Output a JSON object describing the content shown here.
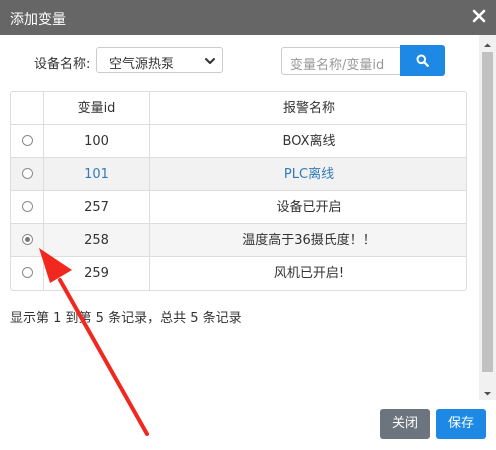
{
  "dialog": {
    "title": "添加变量"
  },
  "filter": {
    "device_label": "设备名称:",
    "device_selected": "空气源热泵",
    "search_placeholder": "变量名称/变量id"
  },
  "table": {
    "columns": [
      "",
      "变量id",
      "报警名称"
    ],
    "rows": [
      {
        "id": "100",
        "name": "BOX离线",
        "selected": false
      },
      {
        "id": "101",
        "name": "PLC离线",
        "selected": false
      },
      {
        "id": "257",
        "name": "设备已开启",
        "selected": false
      },
      {
        "id": "258",
        "name": "温度高于36摄氏度！！",
        "selected": true
      },
      {
        "id": "259",
        "name": "风机已开启!",
        "selected": false
      }
    ]
  },
  "pagination": {
    "summary": "显示第 1 到第 5 条记录，总共 5 条记录"
  },
  "footer": {
    "close_label": "关闭",
    "save_label": "保存"
  },
  "icons": {
    "close": "close-icon",
    "search": "search-icon",
    "dropdown": "chevron-down-icon"
  },
  "colors": {
    "primary": "#1e88e5",
    "titlebar": "#666666",
    "close_button": "#6c757d",
    "annotation_arrow": "#f0281e",
    "link": "#337ab7"
  }
}
